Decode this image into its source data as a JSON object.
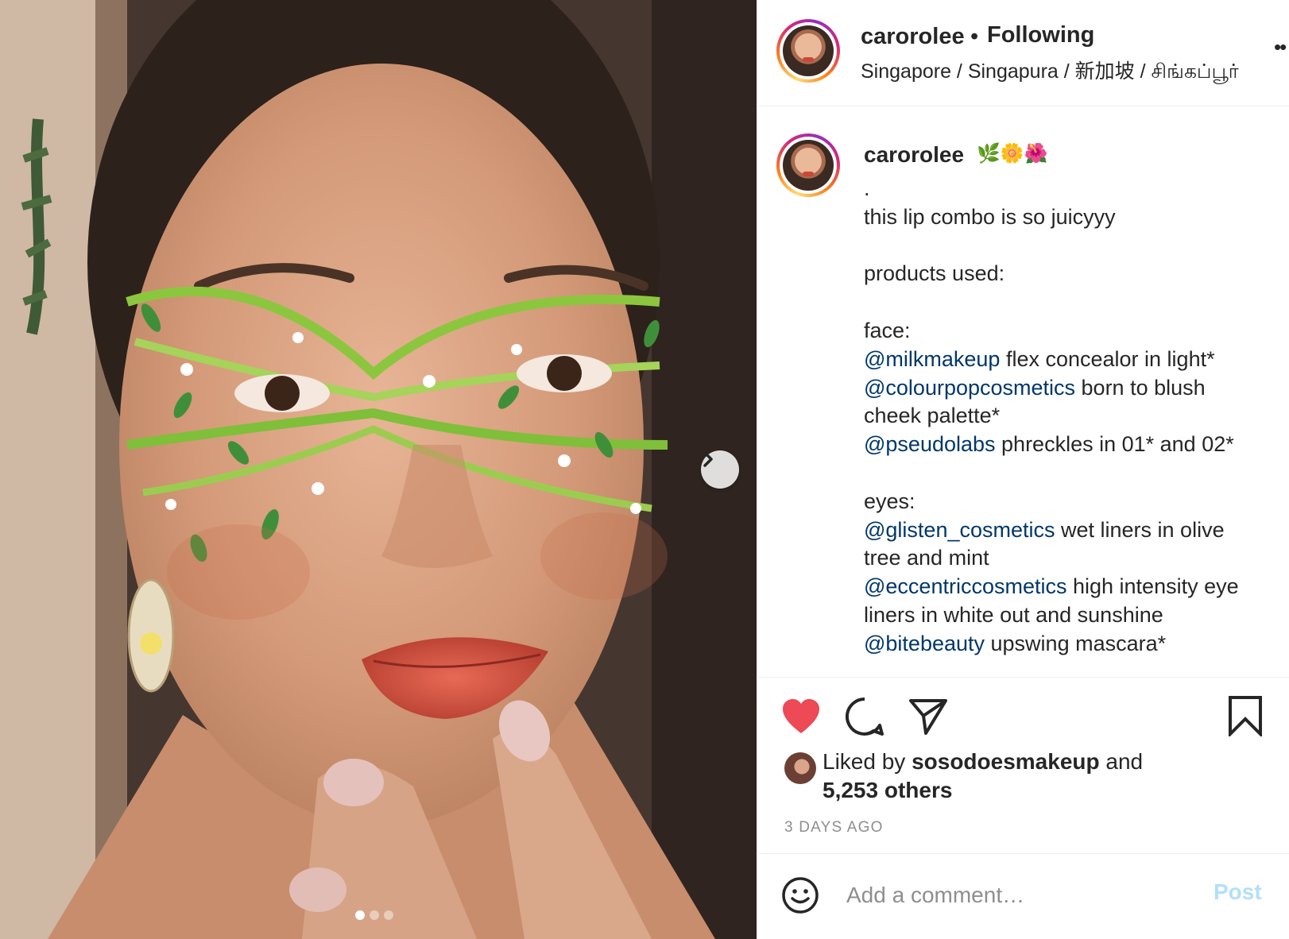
{
  "post": {
    "username": "carorolee",
    "separator": "•",
    "follow_status": "Following",
    "location": "Singapore / Singapura / 新加坡 / சிங்கப்பூர்",
    "more_icon": "more-options-icon"
  },
  "caption": {
    "username": "carorolee",
    "emojis": "🌿🌼🌺",
    "lines": [
      {
        "text": "."
      },
      {
        "text": "this lip combo is so juicyyy"
      },
      {
        "text": ""
      },
      {
        "text": "products used:"
      },
      {
        "text": ""
      },
      {
        "text": "face:"
      }
    ],
    "items": [
      {
        "mention": "@milkmakeup",
        "text": " flex concealor in light*"
      },
      {
        "mention": "@colourpopcosmetics",
        "text": " born to blush cheek palette*"
      },
      {
        "mention": "@pseudolabs",
        "text": " phreckles in 01* and 02*"
      }
    ],
    "eyes_label": "eyes:",
    "eye_items": [
      {
        "mention": "@glisten_cosmetics",
        "text": " wet liners in olive tree and mint"
      },
      {
        "mention": "@eccentriccosmetics",
        "text": " high intensity eye liners in white out and sunshine"
      },
      {
        "mention": "@bitebeauty",
        "text": " upswing mascara*"
      }
    ]
  },
  "actions": {
    "liked_prefix": "Liked by ",
    "liked_by_user": "sosodoesmakeup",
    "liked_conj": " and",
    "others": "5,253 others",
    "timestamp": "3 DAYS AGO",
    "like_color": "#ed4956"
  },
  "comment": {
    "placeholder": "Add a comment…",
    "post_label": "Post",
    "post_color": "#b2dffc"
  },
  "carousel": {
    "slide_count": 3,
    "active_slide": 1
  }
}
